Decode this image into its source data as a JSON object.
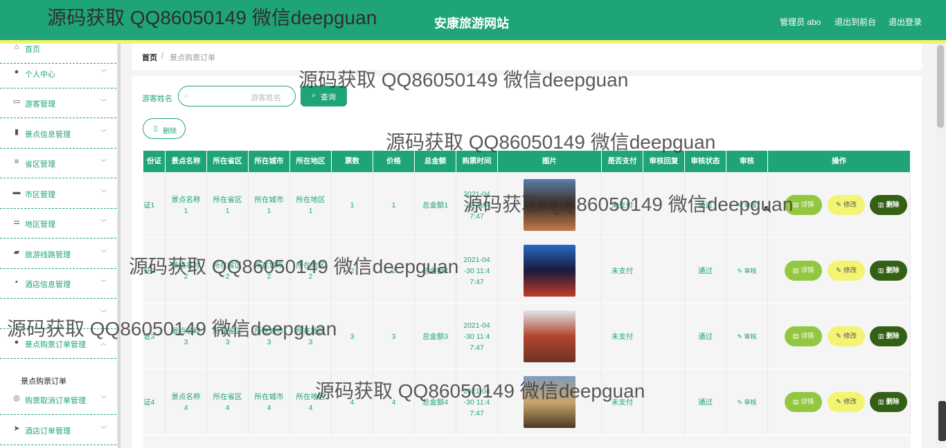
{
  "header": {
    "site_title": "安康旅游网站",
    "admin_label": "管理员 abo",
    "back_front_label": "退出到前台",
    "logout_label": "退出登录"
  },
  "sidebar": {
    "items": [
      {
        "label": "首页",
        "icon": "home-icon",
        "glyph": "⌂",
        "expandable": false
      },
      {
        "label": "个人中心",
        "icon": "user-icon",
        "glyph": "●",
        "expandable": true
      },
      {
        "label": "游客管理",
        "icon": "id-card-icon",
        "glyph": "▭",
        "expandable": true
      },
      {
        "label": "景点信息管理",
        "icon": "clipboard-icon",
        "glyph": "▮",
        "expandable": true
      },
      {
        "label": "省区管理",
        "icon": "list-icon",
        "glyph": "≡",
        "expandable": true
      },
      {
        "label": "市区管理",
        "icon": "bus-icon",
        "glyph": "▬",
        "expandable": true
      },
      {
        "label": "地区管理",
        "icon": "sliders-icon",
        "glyph": "⚌",
        "expandable": true
      },
      {
        "label": "旅游线路管理",
        "icon": "camera-icon",
        "glyph": "▰",
        "expandable": true
      },
      {
        "label": "酒店信息管理",
        "icon": "comment-icon",
        "glyph": "▪",
        "expandable": true
      },
      {
        "label": "",
        "icon": "",
        "glyph": "",
        "expandable": true
      },
      {
        "label": "景点购票订单管理",
        "icon": "user-icon",
        "glyph": "●",
        "expandable": true,
        "expanded": true
      },
      {
        "label": "购票取消订单管理",
        "icon": "compass-icon",
        "glyph": "◎",
        "expandable": true
      },
      {
        "label": "酒店订单管理",
        "icon": "send-icon",
        "glyph": "➤",
        "expandable": true
      }
    ],
    "sub_item": "景点购票订单"
  },
  "breadcrumb": {
    "home": "首页",
    "separator": "/",
    "current": "景点购票订单"
  },
  "search": {
    "label": "游客姓名",
    "placeholder": "游客姓名",
    "button_label": "查询",
    "delete_label": "删除"
  },
  "table": {
    "headers": [
      "份证",
      "景点名称",
      "所在省区",
      "所在城市",
      "所在地区",
      "票数",
      "价格",
      "总金额",
      "购票时间",
      "图片",
      "是否支付",
      "审核回复",
      "审核状态",
      "审核",
      "操作"
    ],
    "rows": [
      {
        "idcard": "证1",
        "name": "景点名称\n1",
        "province": "所在省区\n1",
        "city": "所在城市\n1",
        "area": "所在地区\n1",
        "tickets": "1",
        "price": "1",
        "total": "总金额1",
        "time": "2021-04\n-30 11:4\n7:47",
        "paid": "未支付",
        "reply": "",
        "status": "通过",
        "audit": "审核",
        "thumb_colors": [
          "#5a7fa8",
          "#3a2a22",
          "#c27c4a"
        ]
      },
      {
        "idcard": "证2",
        "name": "景点名称\n2",
        "province": "所在省区\n2",
        "city": "所在城市\n2",
        "area": "所在地区\n2",
        "tickets": "2",
        "price": "2",
        "total": "总金额2",
        "time": "2021-04\n-30 11:4\n7:47",
        "paid": "未支付",
        "reply": "",
        "status": "通过",
        "audit": "审核",
        "thumb_colors": [
          "#2a68c2",
          "#1a1a3a",
          "#c23a2a"
        ]
      },
      {
        "idcard": "证3",
        "name": "景点名称\n3",
        "province": "所在省区\n3",
        "city": "所在城市\n3",
        "area": "所在地区\n3",
        "tickets": "3",
        "price": "3",
        "total": "总金额3",
        "time": "2021-04\n-30 11:4\n7:47",
        "paid": "未支付",
        "reply": "",
        "status": "通过",
        "audit": "审核",
        "thumb_colors": [
          "#e0e4ea",
          "#b2442e",
          "#6e3424"
        ]
      },
      {
        "idcard": "证4",
        "name": "景点名称\n4",
        "province": "所在省区\n4",
        "city": "所在城市\n4",
        "area": "所在地区\n4",
        "tickets": "4",
        "price": "4",
        "total": "总金额4",
        "time": "2021-04\n-30 11:4\n7:47",
        "paid": "未支付",
        "reply": "",
        "status": "通过",
        "audit": "审核",
        "thumb_colors": [
          "#7f9bbb",
          "#c8a46c",
          "#4e3a22"
        ]
      }
    ],
    "actions": {
      "detail": "详情",
      "edit": "修改",
      "delete": "删除"
    }
  },
  "watermark": "源码获取 QQ86050149 微信deepguan",
  "colors": {
    "primary": "#1fa47a",
    "stripe": "#f3f36a",
    "detail_btn": "#93c740",
    "edit_btn": "#f4f473",
    "delete_btn": "#336014"
  }
}
